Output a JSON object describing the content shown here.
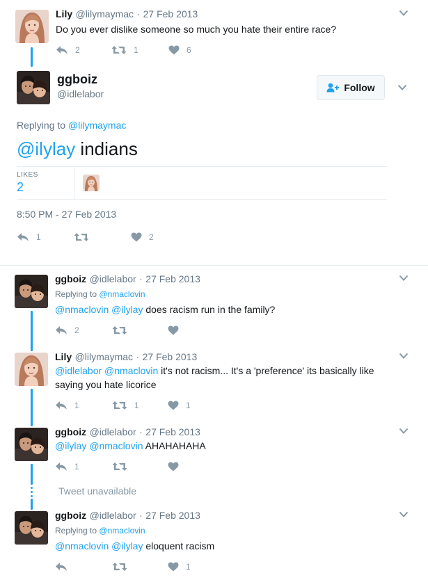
{
  "tweets": {
    "top": {
      "name": "Lily",
      "handle": "@lilymaymac",
      "date": "27 Feb 2013",
      "text": "Do you ever dislike someone so much you hate their entire race?",
      "replies": "2",
      "retweets": "1",
      "likes": "6"
    },
    "main": {
      "name": "ggboiz",
      "handle": "@idlelabor",
      "follow_label": "Follow",
      "replying_label": "Replying to",
      "replying_to": "@lilymaymac",
      "text_mention": "@ilylay",
      "text_rest": "indians",
      "likes_label": "LIKES",
      "likes_count": "2",
      "timestamp": "8:50 PM - 27 Feb 2013",
      "replies": "1",
      "likes": "2"
    },
    "reply1": {
      "name": "ggboiz",
      "handle": "@idlelabor",
      "date": "27 Feb 2013",
      "replying_label": "Replying to",
      "replying_to": "@nmaclovin",
      "mention1": "@nmaclovin",
      "mention2": "@ilylay",
      "text_rest": "does racism run in the family?",
      "replies": "2"
    },
    "reply2": {
      "name": "Lily",
      "handle": "@lilymaymac",
      "date": "27 Feb 2013",
      "mention1": "@idlelabor",
      "mention2": "@nmaclovin",
      "text_line1": "it's not racism... It's a 'preference' its basically like",
      "text_line2": "saying you hate licorice",
      "replies": "1",
      "retweets": "1",
      "likes": "1"
    },
    "reply3": {
      "name": "ggboiz",
      "handle": "@idlelabor",
      "date": "27 Feb 2013",
      "mention1": "@ilylay",
      "mention2": "@nmaclovin",
      "text_rest": "AHAHAHAHA",
      "replies": "1"
    },
    "unavailable": "Tweet unavailable",
    "reply4": {
      "name": "ggboiz",
      "handle": "@idlelabor",
      "date": "27 Feb 2013",
      "replying_label": "Replying to",
      "replying_to": "@nmaclovin",
      "mention1": "@nmaclovin",
      "mention2": "@ilylay",
      "text_rest": "eloquent racism",
      "likes": "1"
    }
  },
  "separator": "·",
  "colors": {
    "accent": "#1da1f2",
    "muted": "#657786",
    "icon": "#8899a6",
    "divider": "#e6ecf0"
  },
  "icons": {
    "reply": "reply-icon",
    "retweet": "retweet-icon",
    "like": "heart-icon",
    "menu": "chevron-down-icon",
    "follow": "add-user-icon"
  }
}
